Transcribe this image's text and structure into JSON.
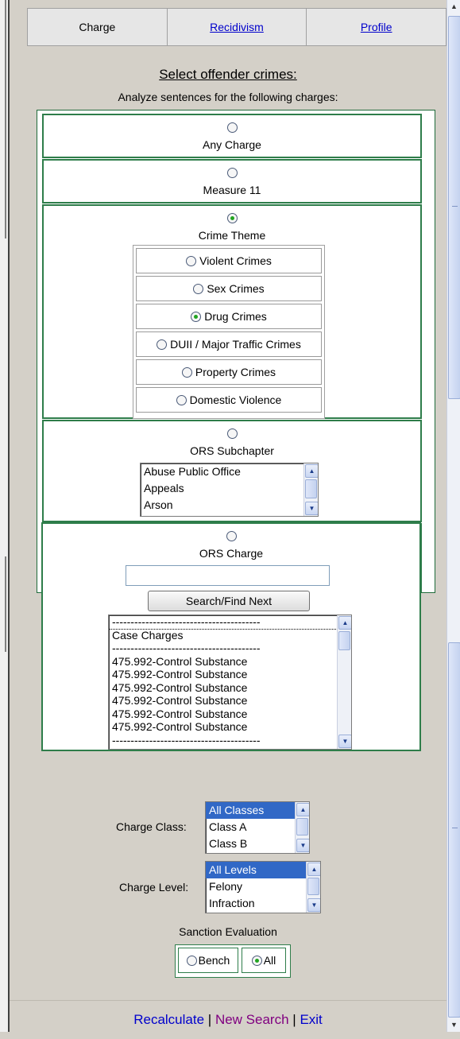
{
  "tabs": {
    "charge": "Charge",
    "recidivism": "Recidivism",
    "profile": "Profile"
  },
  "header": {
    "title": "Select offender crimes:",
    "subtitle": "Analyze sentences for the following charges:"
  },
  "options": {
    "any_charge": "Any Charge",
    "measure11": "Measure 11",
    "crime_theme": "Crime Theme",
    "ors_subchapter": "ORS Subchapter",
    "ors_charge": "ORS Charge"
  },
  "selected_option": "crime_theme",
  "themes": [
    {
      "label": "Violent Crimes",
      "selected": false
    },
    {
      "label": "Sex Crimes",
      "selected": false
    },
    {
      "label": "Drug Crimes",
      "selected": true
    },
    {
      "label": "DUII / Major Traffic Crimes",
      "selected": false
    },
    {
      "label": "Property Crimes",
      "selected": false
    },
    {
      "label": "Domestic Violence",
      "selected": false
    }
  ],
  "subchapters": [
    "Abuse Public Office",
    "Appeals",
    "Arson"
  ],
  "ors_search": {
    "value": "",
    "button": "Search/Find Next"
  },
  "charge_list": [
    "----------------------------------------",
    "Case Charges",
    "----------------------------------------",
    "475.992-Control Substance",
    "475.992-Control Substance",
    "475.992-Control Substance",
    "475.992-Control Substance",
    "475.992-Control Substance",
    "475.992-Control Substance",
    "----------------------------------------"
  ],
  "charge_class": {
    "label": "Charge Class:",
    "options": [
      "All Classes",
      "Class A",
      "Class B"
    ],
    "selected": "All Classes"
  },
  "charge_level": {
    "label": "Charge Level:",
    "options": [
      "All Levels",
      "Felony",
      "Infraction"
    ],
    "selected": "All Levels"
  },
  "sanction": {
    "label": "Sanction Evaluation",
    "bench": "Bench",
    "all": "All",
    "selected": "all"
  },
  "footer": {
    "recalculate": "Recalculate",
    "sep1": "|",
    "new_search": "New Search",
    "sep2": "|",
    "exit": "Exit"
  },
  "colors": {
    "link_blue": "#0000cc",
    "link_purple": "#800080",
    "green_border": "#2e7d4a",
    "selection": "#3168c6"
  }
}
